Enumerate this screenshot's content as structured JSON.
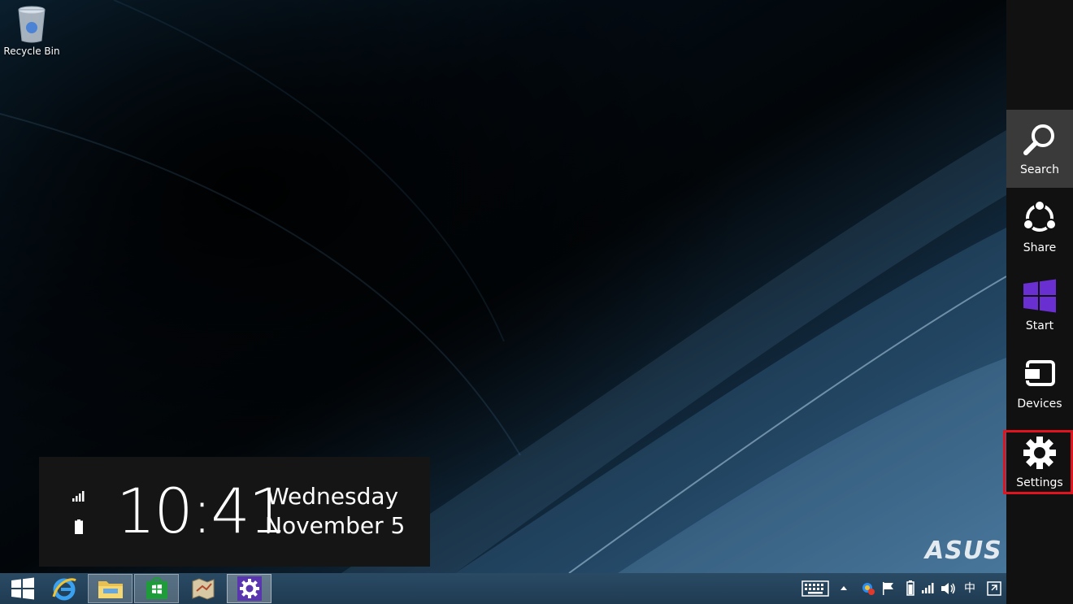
{
  "desktop": {
    "recycle_bin_label": "Recycle Bin",
    "watermark": "ASUS"
  },
  "clock": {
    "time": "10:41",
    "day": "Wednesday",
    "month_day": "November 5"
  },
  "charms": {
    "items": [
      {
        "label": "Search",
        "icon": "search-icon"
      },
      {
        "label": "Share",
        "icon": "share-icon"
      },
      {
        "label": "Start",
        "icon": "windows-logo-icon"
      },
      {
        "label": "Devices",
        "icon": "devices-icon"
      },
      {
        "label": "Settings",
        "icon": "gear-icon"
      }
    ],
    "highlight_color": "#e0141e",
    "start_color": "#6a2fd1"
  },
  "taskbar": {
    "apps": [
      {
        "name": "Start",
        "icon": "windows-logo-icon"
      },
      {
        "name": "Internet Explorer",
        "icon": "internet-explorer-icon"
      },
      {
        "name": "File Explorer",
        "icon": "folder-icon"
      },
      {
        "name": "Store",
        "icon": "store-icon"
      },
      {
        "name": "Maps",
        "icon": "map-icon"
      },
      {
        "name": "Settings",
        "icon": "gear-icon"
      }
    ],
    "tray": [
      "keyboard-icon",
      "show-hidden-icons",
      "network-app-icon",
      "action-center-flag-icon",
      "battery-icon",
      "signal-icon",
      "volume-icon",
      "ime-chinese-icon",
      "snap-icon"
    ],
    "ime_label": "中"
  }
}
